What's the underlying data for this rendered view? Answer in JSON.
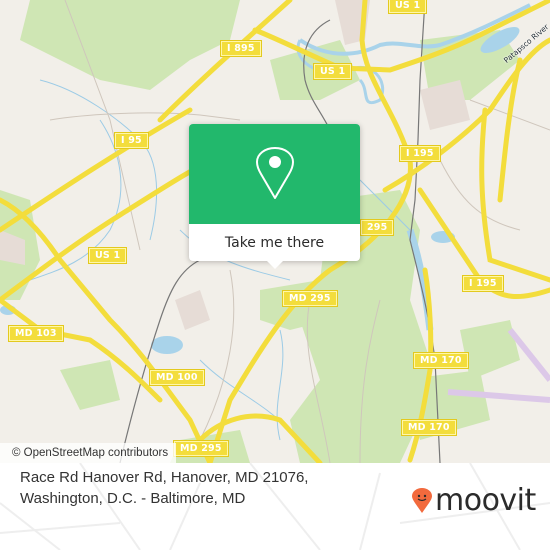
{
  "map": {
    "attribution": "© OpenStreetMap contributors",
    "road_shields": [
      {
        "id": "us1-top",
        "label": "US 1"
      },
      {
        "id": "i895",
        "label": "I 895"
      },
      {
        "id": "us1-mid",
        "label": "US 1"
      },
      {
        "id": "i95",
        "label": "I 95"
      },
      {
        "id": "i195-top",
        "label": "I 195"
      },
      {
        "id": "md295-right",
        "label": "295"
      },
      {
        "id": "us1-left",
        "label": "US 1"
      },
      {
        "id": "md295-center",
        "label": "MD 295"
      },
      {
        "id": "i195-right",
        "label": "I 195"
      },
      {
        "id": "md103",
        "label": "MD 103"
      },
      {
        "id": "md100",
        "label": "MD 100"
      },
      {
        "id": "md170-top",
        "label": "MD 170"
      },
      {
        "id": "md170-bottom",
        "label": "MD 170"
      },
      {
        "id": "md295-bottom",
        "label": "MD 295"
      }
    ],
    "water_labels": [
      {
        "label": "Patapsco River"
      }
    ],
    "colors": {
      "background": "#f2efe9",
      "forest": "#c8e3a8",
      "water": "#a9d3ea",
      "highway": "#f3dd3c",
      "rail": "#777777",
      "airport": "#dcc8e8"
    }
  },
  "popup": {
    "icon": "map-pin-icon",
    "button_label": "Take me there",
    "accent_color": "#22b86c"
  },
  "footer": {
    "address_line1": "Race Rd Hanover Rd, Hanover, MD 21076,",
    "address_line2": "Washington, D.C. - Baltimore, MD",
    "brand": "moovit",
    "brand_color": "#f26a3d"
  }
}
